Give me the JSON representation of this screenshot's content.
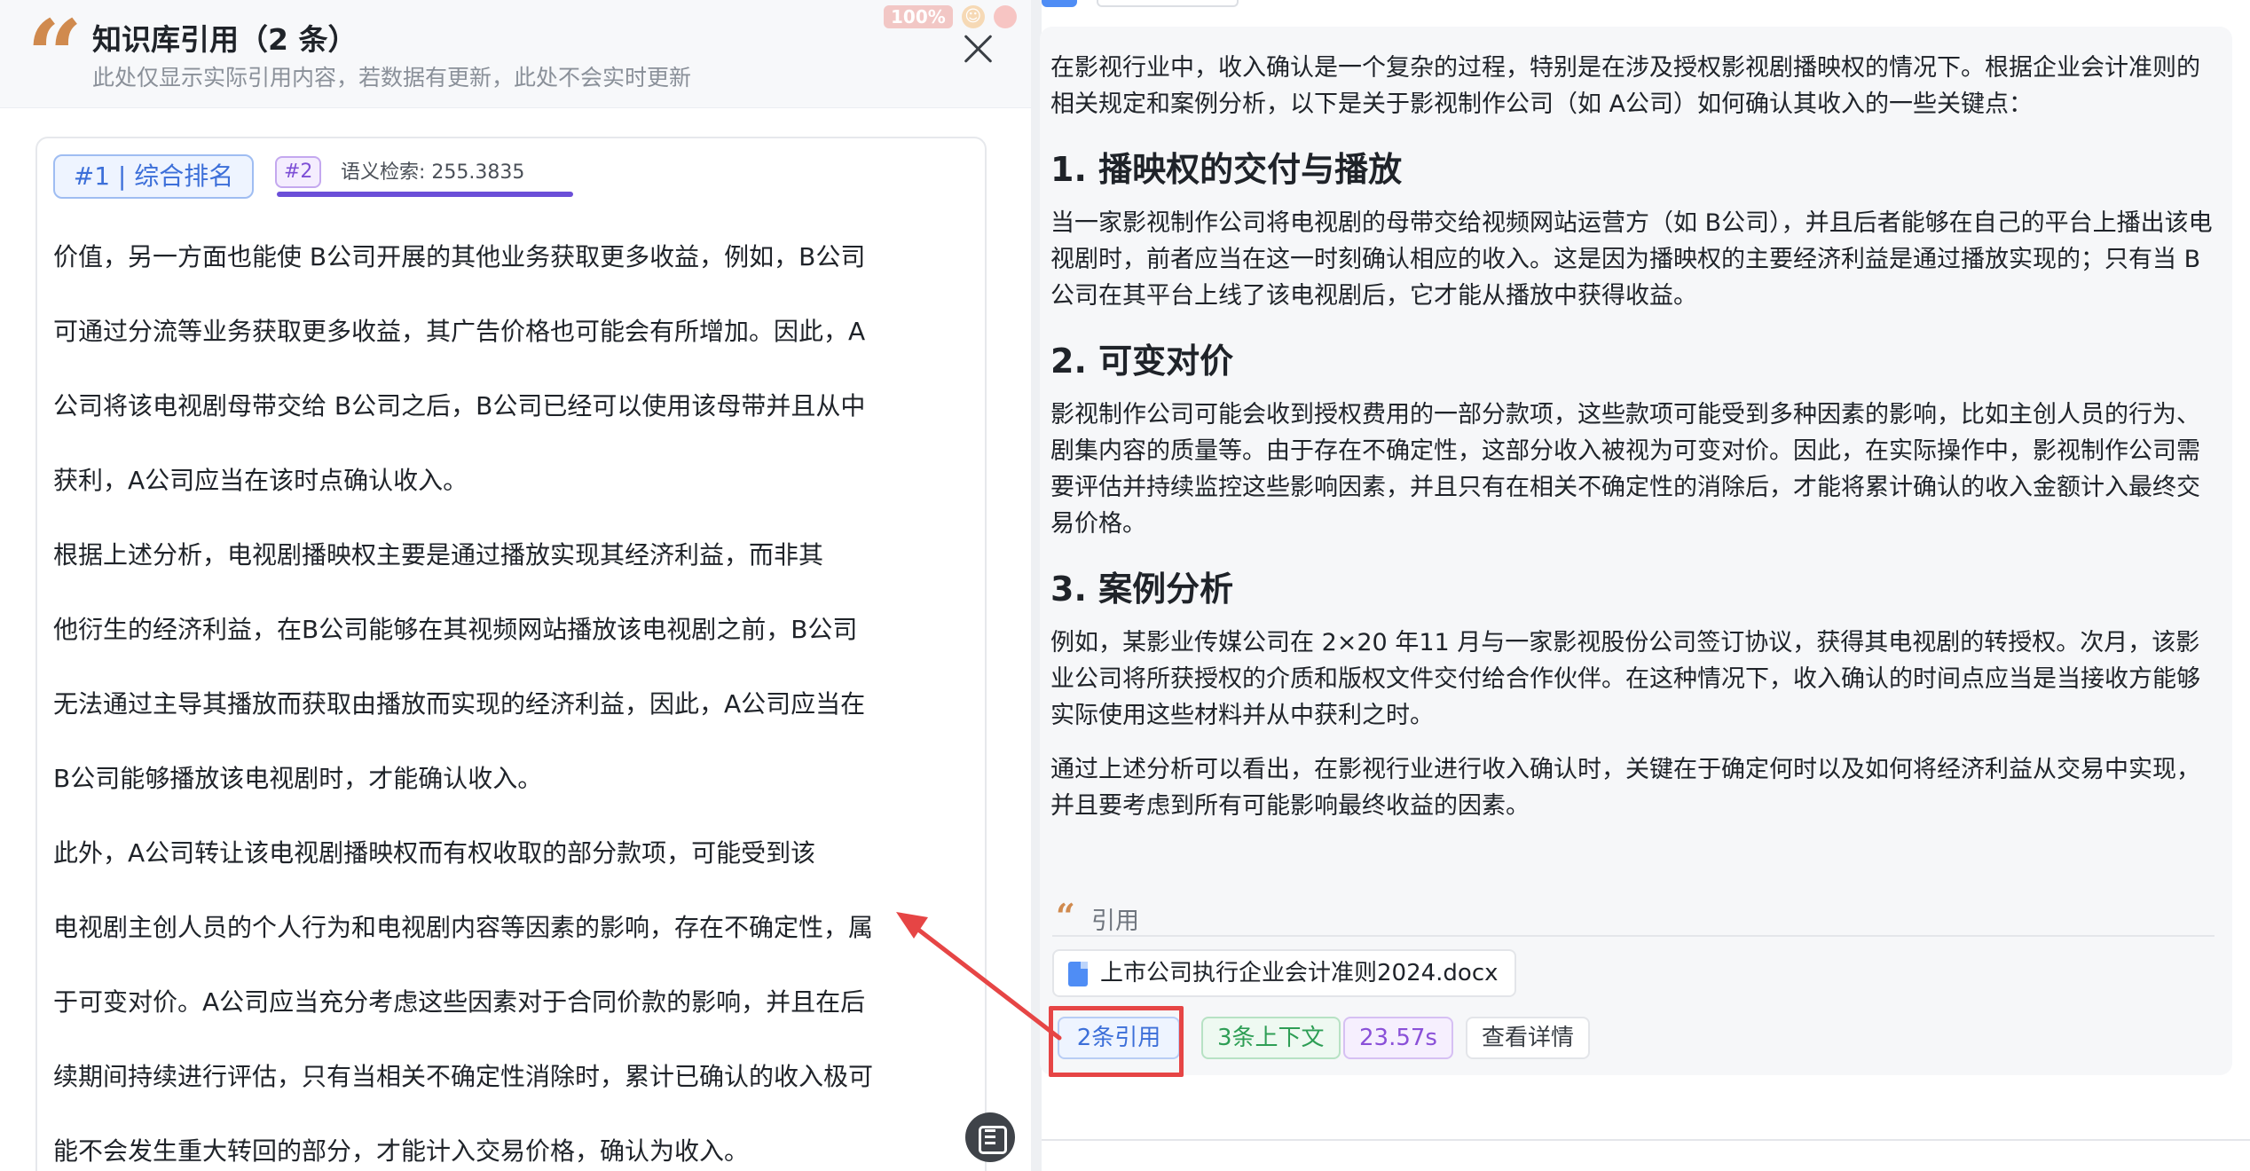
{
  "window": {
    "zoom": "100%"
  },
  "left_panel": {
    "title": "知识库引用（2 条）",
    "subtitle": "此处仅显示实际引用内容，若数据有更新，此处不会实时更新",
    "tabs": {
      "rank_label": "#1 | 综合排名",
      "num_label": "#2",
      "semantic_label": "语义检索: 255.3835"
    },
    "lines": [
      "价值，另一方面也能使 B公司开展的其他业务获取更多收益，例如，B公司",
      "可通过分流等业务获取更多收益，其广告价格也可能会有所增加。因此，A",
      "公司将该电视剧母带交给 B公司之后，B公司已经可以使用该母带并且从中",
      "获利，A公司应当在该时点确认收入。",
      "根据上述分析，电视剧播映权主要是通过播放实现其经济利益，而非其",
      "他衍生的经济利益，在B公司能够在其视频网站播放该电视剧之前，B公司",
      "无法通过主导其播放而获取由播放而实现的经济利益，因此，A公司应当在",
      "B公司能够播放该电视剧时，才能确认收入。",
      "此外，A公司转让该电视剧播映权而有权收取的部分款项，可能受到该",
      "电视剧主创人员的个人行为和电视剧内容等因素的影响，存在不确定性，属",
      "于可变对价。A公司应当充分考虑这些因素对于合同价款的影响，并且在后",
      "续期间持续进行评估，只有当相关不确定性消除时，累计已确认的收入极可",
      "能不会发生重大转回的部分，才能计入交易价格，确认为收入。"
    ]
  },
  "answer": {
    "intro": "在影视行业中，收入确认是一个复杂的过程，特别是在涉及授权影视剧播映权的情况下。根据企业会计准则的相关规定和案例分析，以下是关于影视制作公司（如 A公司）如何确认其收入的一些关键点：",
    "sections": [
      {
        "heading": "1. 播映权的交付与播放",
        "body": "当一家影视制作公司将电视剧的母带交给视频网站运营方（如 B公司），并且后者能够在自己的平台上播出该电视剧时，前者应当在这一时刻确认相应的收入。这是因为播映权的主要经济利益是通过播放实现的；只有当 B公司在其平台上线了该电视剧后，它才能从播放中获得收益。"
      },
      {
        "heading": "2. 可变对价",
        "body": "影视制作公司可能会收到授权费用的一部分款项，这些款项可能受到多种因素的影响，比如主创人员的行为、剧集内容的质量等。由于存在不确定性，这部分收入被视为可变对价。因此，在实际操作中，影视制作公司需要评估并持续监控这些影响因素，并且只有在相关不确定性的消除后，才能将累计确认的收入金额计入最终交易价格。"
      },
      {
        "heading": "3. 案例分析",
        "body": "例如，某影业传媒公司在 2×20 年11 月与一家影视股份公司签订协议，获得其电视剧的转授权。次月，该影业公司将所获授权的介质和版权文件交付给合作伙伴。在这种情况下，收入确认的时间点应当是当接收方能够实际使用这些材料并从中获利之时。"
      }
    ],
    "conclusion": "通过上述分析可以看出，在影视行业进行收入确认时，关键在于确定何时以及如何将经济利益从交易中实现，并且要考虑到所有可能影响最终收益的因素。",
    "citation_label": "引用",
    "file_name": "上市公司执行企业会计准则2024.docx",
    "badges": {
      "cite": "2条引用",
      "context": "3条上下文",
      "time": "23.57s",
      "detail": "查看详情"
    }
  },
  "colors": {
    "accent_blue": "#3c6fd9",
    "quote_orange": "#d08a4e",
    "highlight_red": "#e64545",
    "purple": "#6b4fd8"
  }
}
